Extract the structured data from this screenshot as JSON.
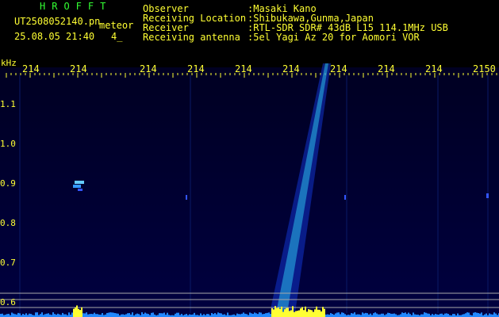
{
  "header": {
    "brand": "HROFFT",
    "filename": "UT2508052140.pn",
    "meteor_type": "meteor",
    "timestamp": "25.08.05 21:40",
    "count": "4_",
    "rows": [
      {
        "label": "Observer",
        "value": ":Masaki Kano"
      },
      {
        "label": "Receiving Location",
        "value": ":Shibukawa,Gunma,Japan"
      },
      {
        "label": "Receiver",
        "value": ":RTL-SDR SDR# 43dB L15 114.1MHz USB"
      },
      {
        "label": "Receiving antenna",
        "value": ":5el Yagi Az 20 for Aomori VOR"
      }
    ]
  },
  "axis": {
    "unit": "kHz",
    "x_ticks": [
      "214",
      "214",
      "214",
      "214",
      "214",
      "214",
      "214",
      "214",
      "214",
      "2150"
    ],
    "y_ticks": [
      "1.1",
      "1.0",
      "0.9",
      "0.8",
      "0.7",
      "0.6"
    ]
  },
  "colors": {
    "text_green": "#33ff33",
    "text_yellow": "#ffff33",
    "background": "#000000",
    "signal": "#3355ff"
  }
}
